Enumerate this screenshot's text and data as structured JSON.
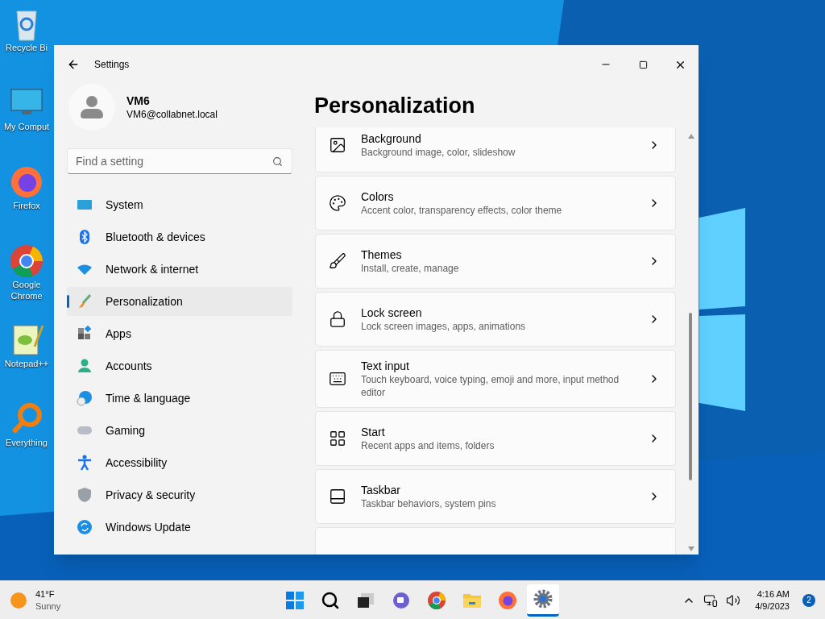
{
  "desktop_icons": [
    {
      "label": "Recycle Bi"
    },
    {
      "label": "My Comput"
    },
    {
      "label": "Firefox"
    },
    {
      "label": "Google Chrome"
    },
    {
      "label": "Notepad++"
    },
    {
      "label": "Everything"
    }
  ],
  "window": {
    "title": "Settings",
    "user": {
      "name": "VM6",
      "email": "VM6@collabnet.local"
    },
    "search": {
      "placeholder": "Find a setting"
    },
    "nav": [
      {
        "label": "System",
        "selected": false
      },
      {
        "label": "Bluetooth & devices",
        "selected": false
      },
      {
        "label": "Network & internet",
        "selected": false
      },
      {
        "label": "Personalization",
        "selected": true
      },
      {
        "label": "Apps",
        "selected": false
      },
      {
        "label": "Accounts",
        "selected": false
      },
      {
        "label": "Time & language",
        "selected": false
      },
      {
        "label": "Gaming",
        "selected": false
      },
      {
        "label": "Accessibility",
        "selected": false
      },
      {
        "label": "Privacy & security",
        "selected": false
      },
      {
        "label": "Windows Update",
        "selected": false
      }
    ],
    "page_title": "Personalization",
    "cards": [
      {
        "title": "Background",
        "subtitle": "Background image, color, slideshow"
      },
      {
        "title": "Colors",
        "subtitle": "Accent color, transparency effects, color theme"
      },
      {
        "title": "Themes",
        "subtitle": "Install, create, manage"
      },
      {
        "title": "Lock screen",
        "subtitle": "Lock screen images, apps, animations"
      },
      {
        "title": "Text input",
        "subtitle": "Touch keyboard, voice typing, emoji and more, input method editor"
      },
      {
        "title": "Start",
        "subtitle": "Recent apps and items, folders"
      },
      {
        "title": "Taskbar",
        "subtitle": "Taskbar behaviors, system pins"
      }
    ]
  },
  "taskbar": {
    "weather": {
      "temperature": "41°F",
      "condition": "Sunny"
    },
    "apps": [
      {
        "kind": "start",
        "selected": false
      },
      {
        "kind": "search",
        "selected": false
      },
      {
        "kind": "taskview",
        "selected": false
      },
      {
        "kind": "chat",
        "selected": false
      },
      {
        "kind": "chrome",
        "selected": false
      },
      {
        "kind": "explorer",
        "selected": false
      },
      {
        "kind": "firefox",
        "selected": false
      },
      {
        "kind": "settings",
        "selected": true
      }
    ],
    "time": "4:16 AM",
    "date": "4/9/2023",
    "notification_count": "2"
  }
}
